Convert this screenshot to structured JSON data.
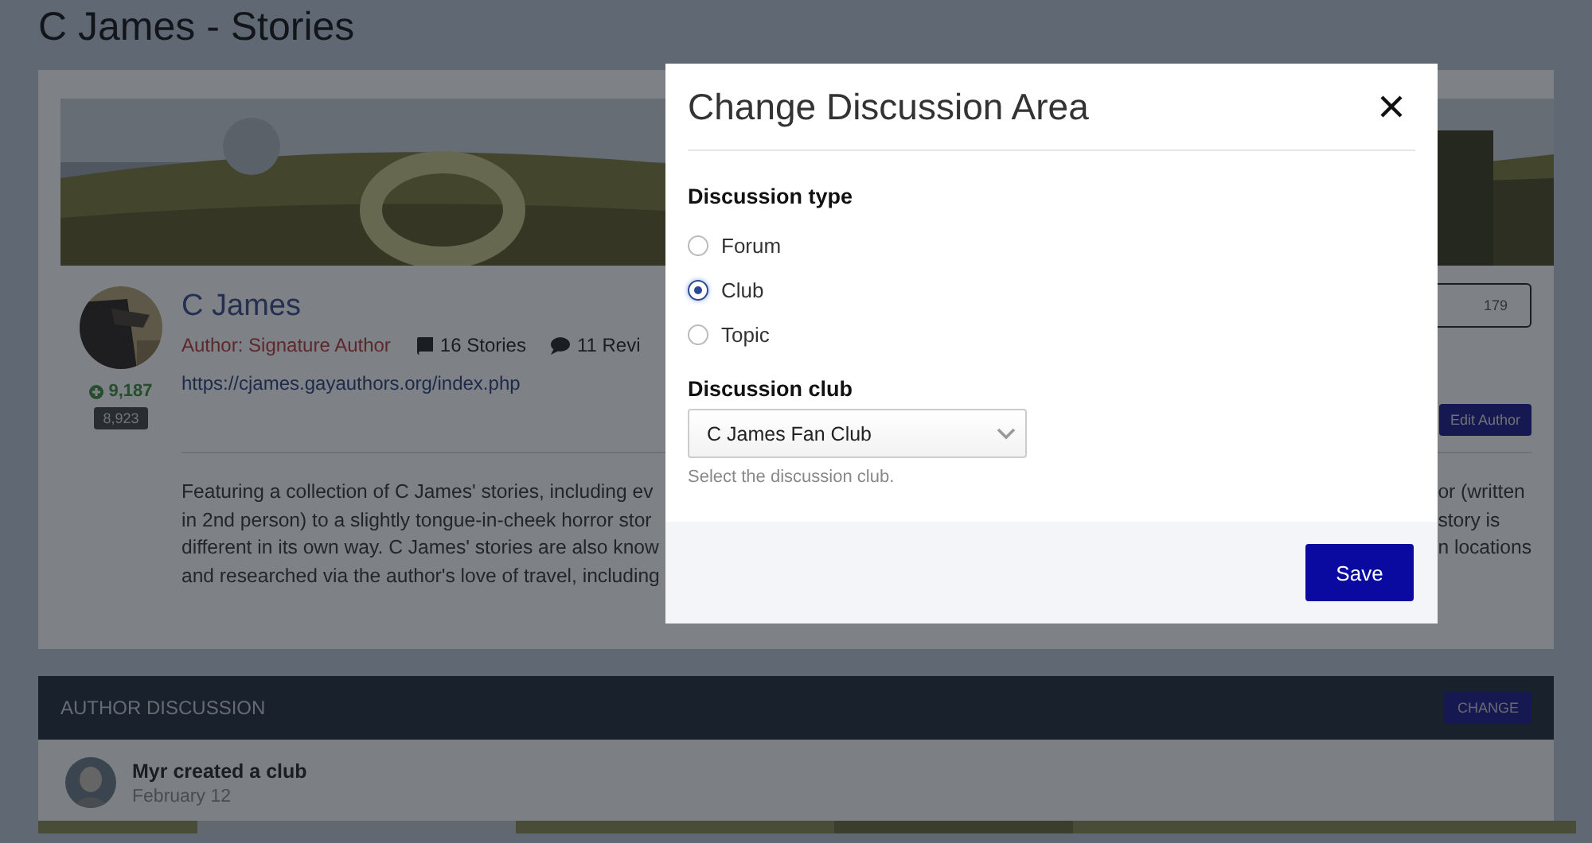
{
  "page_title": "C James - Stories",
  "author": {
    "name": "C James",
    "rank": "Author: Signature Author",
    "stories": "16 Stories",
    "reviews": "11 Revi",
    "url": "https://cjames.gayauthors.org/index.php",
    "reputation": "9,187",
    "points": "8,923",
    "stat": "179",
    "edit_button": "Edit Author"
  },
  "description": {
    "left_lines": [
      "Featuring a collection of C James' stories, including ev",
      "in 2nd person) to a slightly tongue-in-cheek horror stor",
      "different in its own way. C James' stories are also know",
      "and researched via the author's love of travel, including"
    ],
    "right_lines": [
      "or (written",
      "story is",
      "n locations"
    ]
  },
  "discussion": {
    "header": "AUTHOR DISCUSSION",
    "change_button": "CHANGE",
    "activity": {
      "title": "Myr created a club",
      "date": "February 12"
    }
  },
  "modal": {
    "title": "Change Discussion Area",
    "type_label": "Discussion type",
    "options": [
      {
        "label": "Forum",
        "selected": false
      },
      {
        "label": "Club",
        "selected": true
      },
      {
        "label": "Topic",
        "selected": false
      }
    ],
    "club_label": "Discussion club",
    "club_value": "C James Fan Club",
    "club_help": "Select the discussion club.",
    "save_button": "Save"
  }
}
